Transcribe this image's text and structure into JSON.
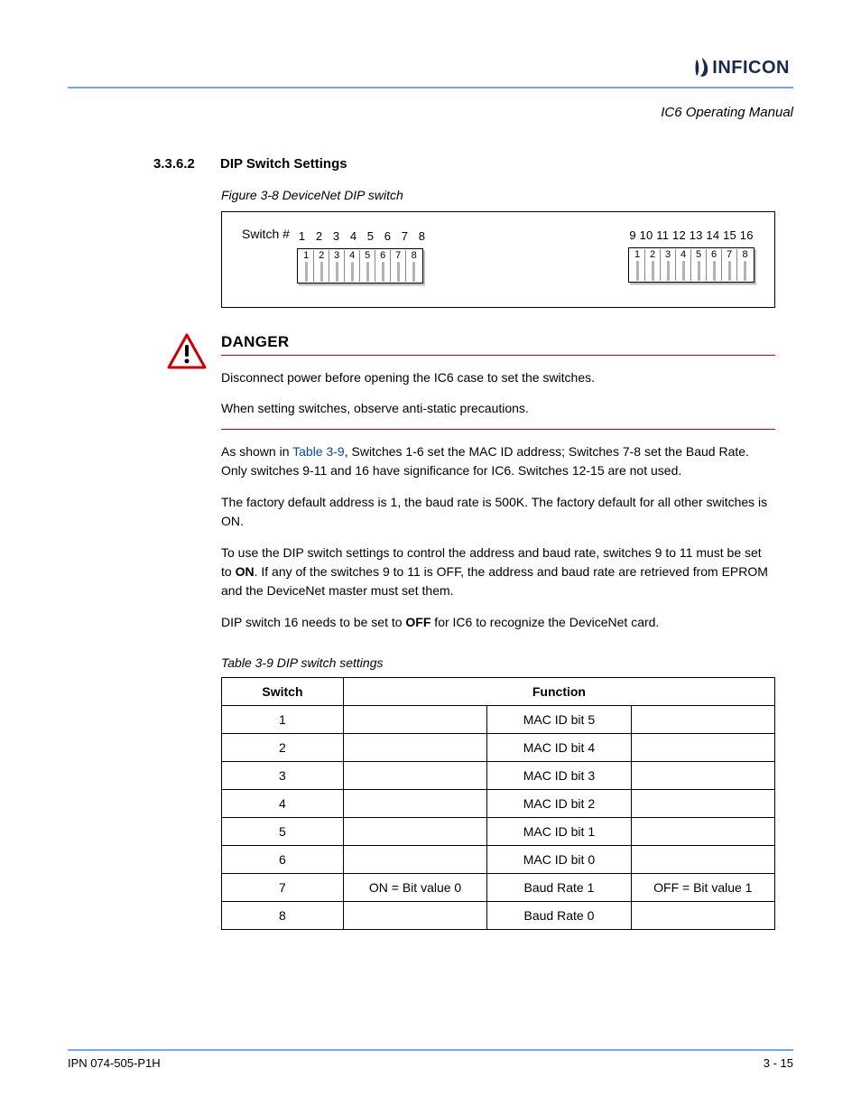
{
  "header": {
    "logo_text": "INFICON"
  },
  "doc_title": "IC6 Operating Manual",
  "section": {
    "number": "3.3.6.2",
    "title": "DIP Switch Settings"
  },
  "figure": {
    "caption": "Figure 3-8 DeviceNet DIP switch",
    "switch_label": "Switch #",
    "group1_external": [
      "1",
      "2",
      "3",
      "4",
      "5",
      "6",
      "7",
      "8"
    ],
    "group1_internal": [
      "1",
      "2",
      "3",
      "4",
      "5",
      "6",
      "7",
      "8"
    ],
    "group2_external": [
      "9",
      "10",
      "11",
      "12",
      "13",
      "14",
      "15",
      "16"
    ],
    "group2_internal": [
      "1",
      "2",
      "3",
      "4",
      "5",
      "6",
      "7",
      "8"
    ]
  },
  "danger": {
    "heading": "DANGER",
    "lines": [
      "Disconnect power before opening the IC6 case to set the switches.",
      "When setting switches, observe anti-static precautions."
    ]
  },
  "body": {
    "p1_prefix": "As shown in ",
    "p1_link": "Table 3-9",
    "p1_suffix": ", Switches 1-6 set the MAC ID address; Switches 7-8 set the Baud Rate. Only switches 9-11 and 16 have significance for IC6. Switches 12-15 are not used.",
    "p2": "The factory default address is 1, the baud rate is 500K. The factory default for all other switches is ON.",
    "p3_prefix": "To use the DIP switch settings to control the address and baud rate, switches 9 to 11 must be set to ",
    "p3_bold": "ON",
    "p3_suffix": ". If any of the switches 9 to 11 is OFF, the address and baud rate are retrieved from EPROM and the DeviceNet master must set them.",
    "p4_prefix": "DIP switch 16 needs to be set to ",
    "p4_bold": "OFF",
    "p4_suffix": " for IC6 to recognize the DeviceNet card."
  },
  "table": {
    "caption": "Table 3-9 DIP switch settings",
    "headers": [
      "Switch",
      "Function"
    ],
    "rows": [
      {
        "switch": "1",
        "on": "",
        "label": "MAC ID bit 5",
        "off": ""
      },
      {
        "switch": "2",
        "on": "",
        "label": "MAC ID bit 4",
        "off": ""
      },
      {
        "switch": "3",
        "on": "",
        "label": "MAC ID bit 3",
        "off": ""
      },
      {
        "switch": "4",
        "on": "",
        "label": "MAC ID bit 2",
        "off": ""
      },
      {
        "switch": "5",
        "on": "",
        "label": "MAC ID bit 1",
        "off": ""
      },
      {
        "switch": "6",
        "on": "",
        "label": "MAC ID bit 0",
        "off": ""
      },
      {
        "switch": "7",
        "on": "ON = Bit value 0",
        "label": "Baud Rate 1",
        "off": "OFF = Bit value 1"
      },
      {
        "switch": "8",
        "on": "",
        "label": "Baud Rate 0",
        "off": ""
      }
    ]
  },
  "footer": {
    "left": "IPN 074-505-P1H",
    "right": "3 - 15"
  }
}
